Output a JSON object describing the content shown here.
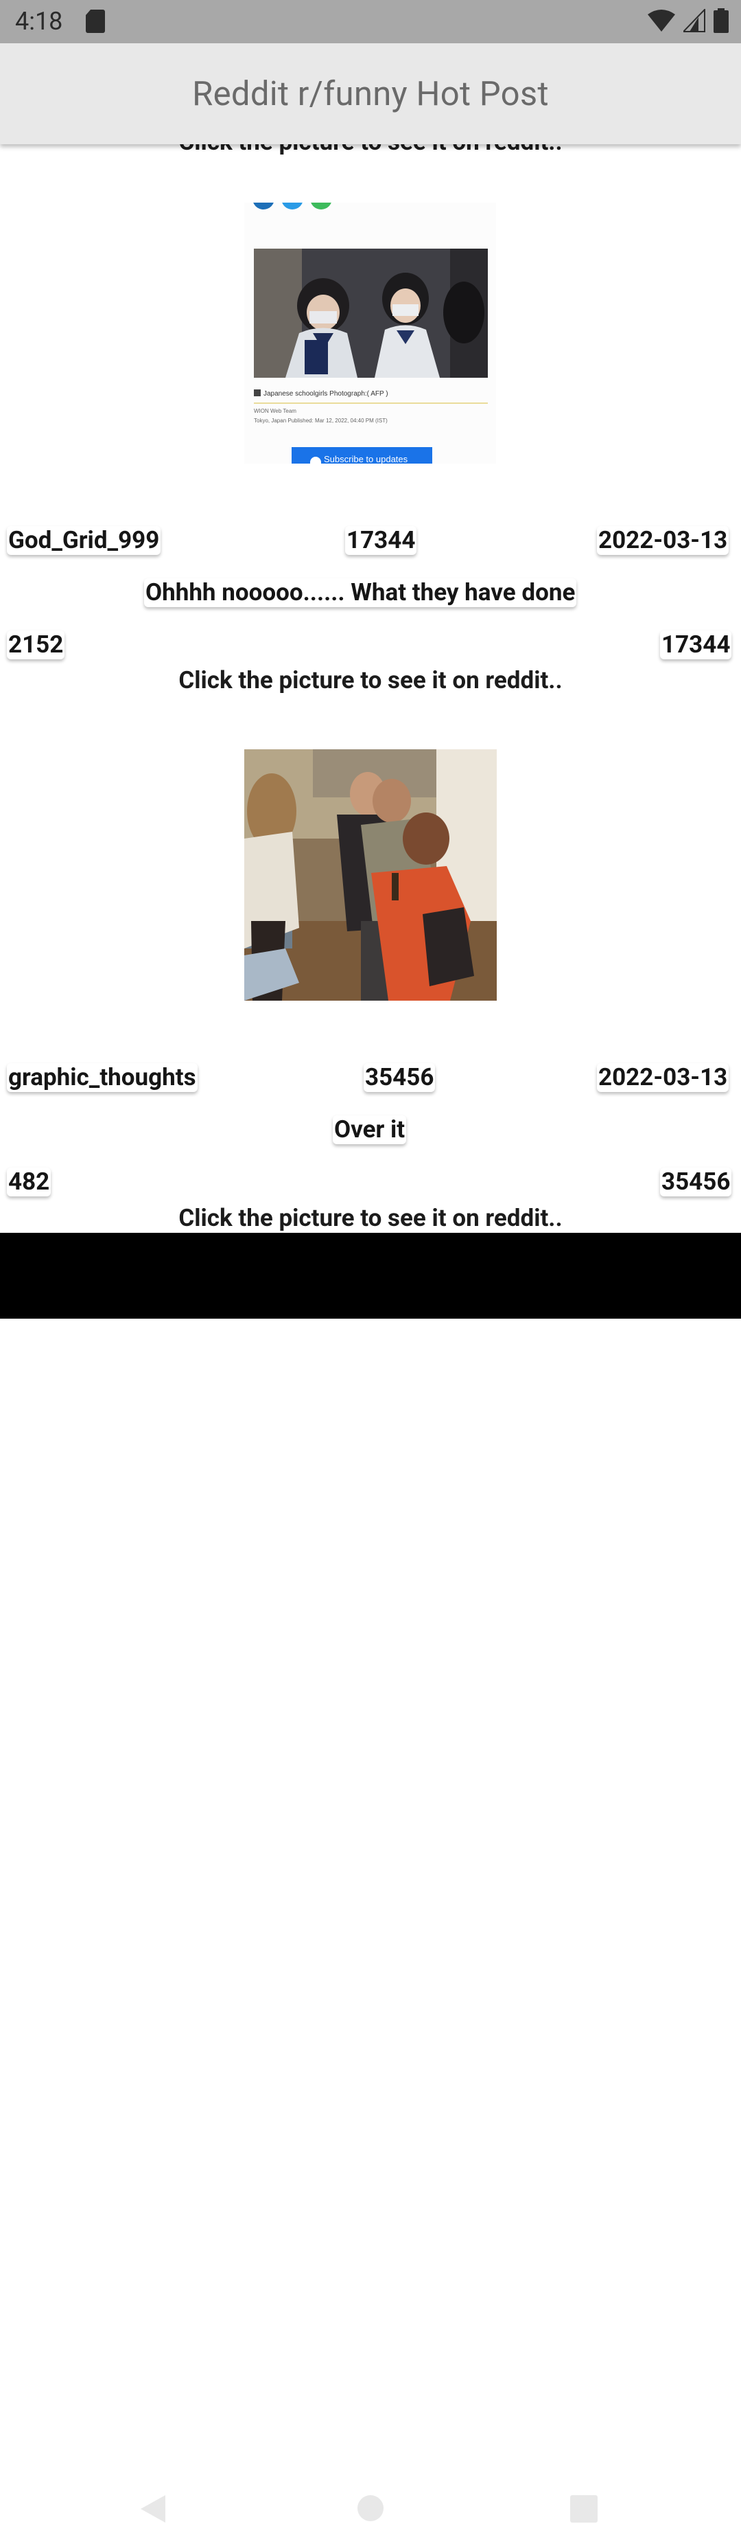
{
  "status_bar": {
    "time": "4:18"
  },
  "app_bar": {
    "title": "Reddit r/funny Hot Post"
  },
  "hint_text": "Click the picture to see it on reddit..",
  "posts": [
    {
      "author": "God_Grid_999",
      "score": "17344",
      "date": "2022-03-13",
      "title": "Ohhhh nooooo...... What they have done",
      "comments": "2152",
      "ups": "17344",
      "image": {
        "caption": "Japanese schoolgirls Photograph:( AFP )",
        "byline": "WION Web Team",
        "meta": "Tokyo, Japan Published: Mar 12, 2022, 04:40 PM (IST)",
        "button": "Subscribe to updates"
      }
    },
    {
      "author": "graphic_thoughts",
      "score": "35456",
      "date": "2022-03-13",
      "title": "Over it",
      "comments": "482",
      "ups": "35456"
    }
  ]
}
